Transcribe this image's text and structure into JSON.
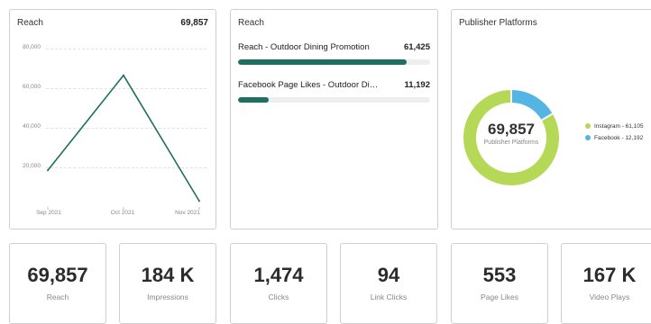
{
  "reach_card": {
    "title": "Reach",
    "total": "69,857",
    "chart_data": {
      "type": "line",
      "categories": [
        "Sep 2021",
        "Oct 2021",
        "Nov 2021"
      ],
      "values": [
        18500,
        66500,
        3000
      ],
      "ylim": [
        0,
        80000
      ],
      "yticks": [
        "80,000",
        "60,000",
        "40,000",
        "20,000"
      ],
      "ytick_values": [
        80000,
        60000,
        40000,
        20000
      ],
      "grid": true,
      "color": "#1f6e5f"
    }
  },
  "campaign_card": {
    "title": "Reach",
    "max": 70000,
    "rows": [
      {
        "label": "Reach - Outdoor Dining Promotion",
        "value_text": "61,425",
        "value": 61425
      },
      {
        "label": "Facebook Page Likes - Outdoor Di…",
        "value_text": "11,192",
        "value": 11192
      }
    ],
    "bar_color": "#1f6e5f"
  },
  "platforms_card": {
    "title": "Publisher Platforms",
    "center_value": "69,857",
    "center_label": "Publisher Platforms",
    "chart_data": {
      "type": "pie",
      "slices": [
        {
          "name": "Instagram",
          "value": 61105,
          "color": "#b5d956"
        },
        {
          "name": "Facebook",
          "value": 12192,
          "color": "#54b4e3"
        }
      ]
    },
    "legend": [
      {
        "text": "Instagram - 61,105",
        "color": "#b5d956"
      },
      {
        "text": "Facebook - 12,192",
        "color": "#54b4e3"
      }
    ]
  },
  "stats": [
    {
      "value": "69,857",
      "label": "Reach"
    },
    {
      "value": "184 K",
      "label": "Impressions"
    },
    {
      "value": "1,474",
      "label": "Clicks"
    },
    {
      "value": "94",
      "label": "Link Clicks"
    },
    {
      "value": "553",
      "label": "Page Likes"
    },
    {
      "value": "167 K",
      "label": "Video Plays"
    }
  ]
}
